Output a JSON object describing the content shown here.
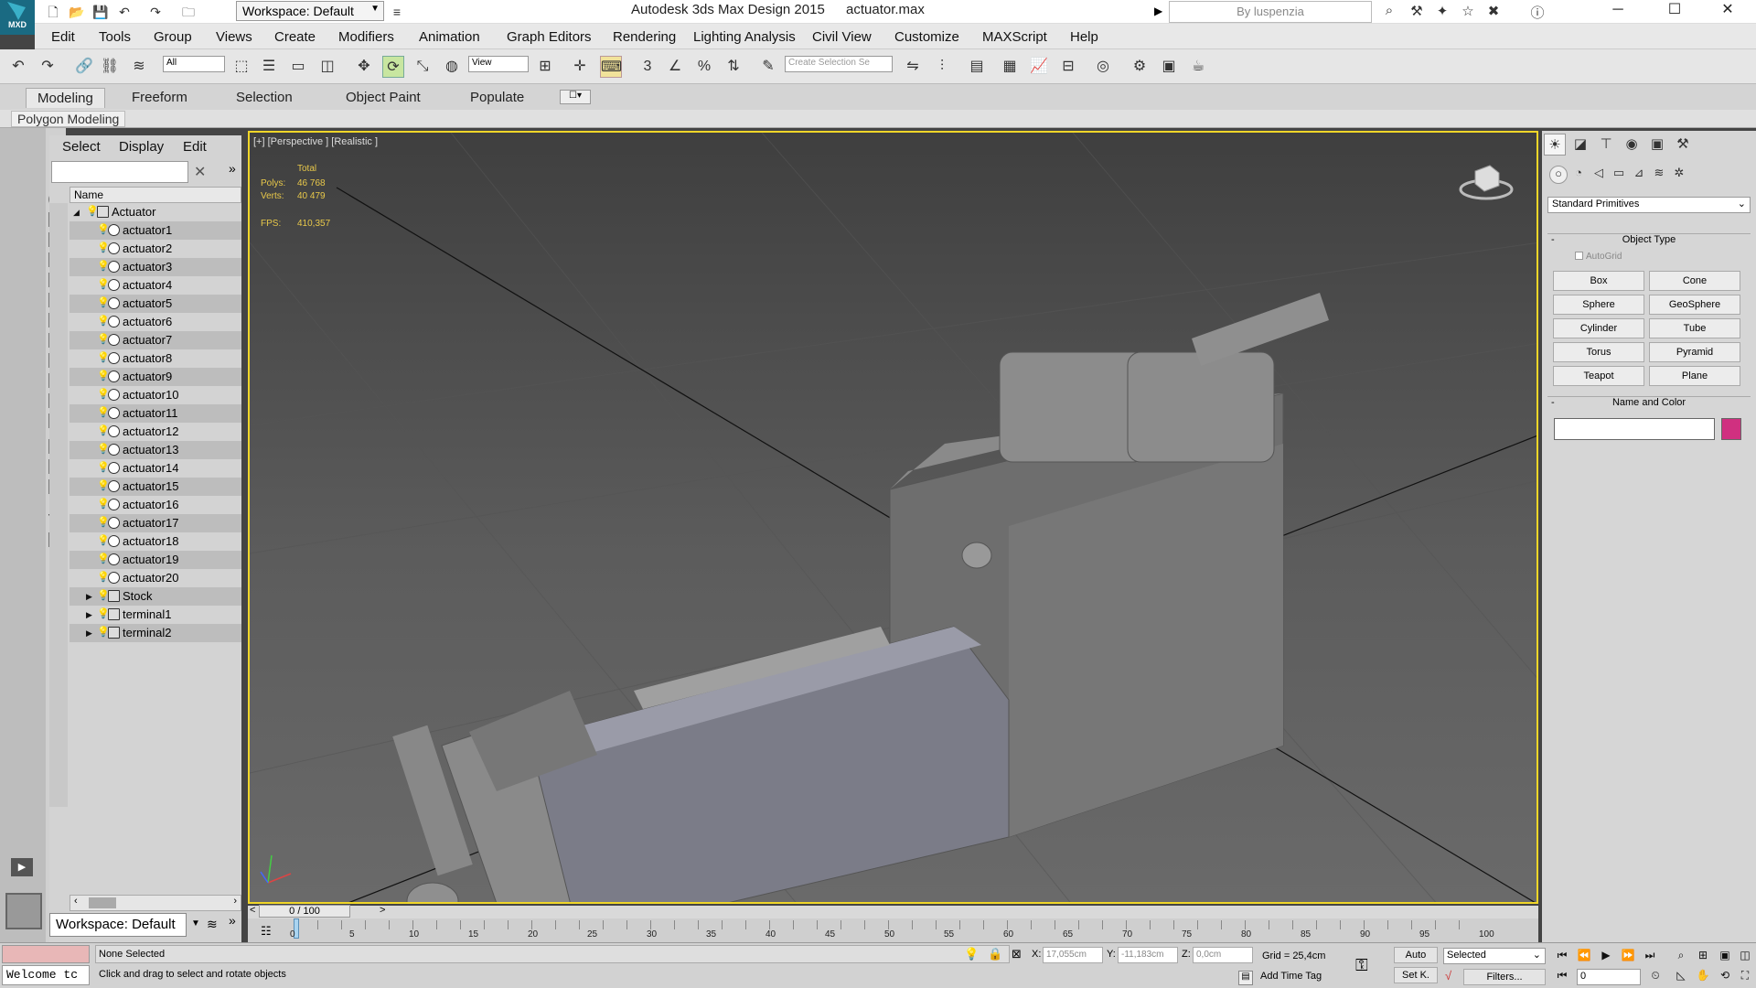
{
  "titlebar": {
    "logo_text": "MXD",
    "workspace": "Workspace: Default",
    "app_title": "Autodesk 3ds Max Design 2015",
    "file_name": "actuator.max",
    "search_placeholder": "By luspenzia"
  },
  "menu": [
    "Edit",
    "Tools",
    "Group",
    "Views",
    "Create",
    "Modifiers",
    "Animation",
    "Graph Editors",
    "Rendering",
    "Lighting Analysis",
    "Civil View",
    "Customize",
    "MAXScript",
    "Help"
  ],
  "main_toolbar": {
    "filter_dd": "All",
    "ref_coord_dd": "View",
    "selection_set_placeholder": "Create Selection Se"
  },
  "ribbon": {
    "tabs": [
      "Modeling",
      "Freeform",
      "Selection",
      "Object Paint",
      "Populate"
    ],
    "active_tab": "Modeling",
    "panel_label": "Polygon Modeling"
  },
  "scene_explorer": {
    "menus": [
      "Select",
      "Display",
      "Edit"
    ],
    "column_header": "Name",
    "root": "Actuator",
    "items": [
      {
        "label": "actuator1",
        "selected": true
      },
      {
        "label": "actuator2",
        "selected": false
      },
      {
        "label": "actuator3",
        "selected": true
      },
      {
        "label": "actuator4",
        "selected": false
      },
      {
        "label": "actuator5",
        "selected": true
      },
      {
        "label": "actuator6",
        "selected": false
      },
      {
        "label": "actuator7",
        "selected": true
      },
      {
        "label": "actuator8",
        "selected": false
      },
      {
        "label": "actuator9",
        "selected": true
      },
      {
        "label": "actuator10",
        "selected": false
      },
      {
        "label": "actuator11",
        "selected": true
      },
      {
        "label": "actuator12",
        "selected": false
      },
      {
        "label": "actuator13",
        "selected": true
      },
      {
        "label": "actuator14",
        "selected": false
      },
      {
        "label": "actuator15",
        "selected": true
      },
      {
        "label": "actuator16",
        "selected": false
      },
      {
        "label": "actuator17",
        "selected": true
      },
      {
        "label": "actuator18",
        "selected": false
      },
      {
        "label": "actuator19",
        "selected": true
      },
      {
        "label": "actuator20",
        "selected": false
      }
    ],
    "groups": [
      "Stock",
      "terminal1",
      "terminal2"
    ],
    "workspace": "Workspace: Default"
  },
  "viewport": {
    "label": "[+] [Perspective ] [Realistic ]",
    "stats_header": "Total",
    "polys_label": "Polys:",
    "polys_value": "46 768",
    "verts_label": "Verts:",
    "verts_value": "40 479",
    "fps_label": "FPS:",
    "fps_value": "410,357"
  },
  "command_panel": {
    "dropdown": "Standard Primitives",
    "object_type_title": "Object Type",
    "autogrid": "AutoGrid",
    "primitives": [
      "Box",
      "Cone",
      "Sphere",
      "GeoSphere",
      "Cylinder",
      "Tube",
      "Torus",
      "Pyramid",
      "Teapot",
      "Plane"
    ],
    "name_color_title": "Name and Color",
    "color": "#d03080"
  },
  "timeline": {
    "slider_value": "0 / 100",
    "ticks": [
      "0",
      "5",
      "10",
      "15",
      "20",
      "25",
      "30",
      "35",
      "40",
      "45",
      "50",
      "55",
      "60",
      "65",
      "70",
      "75",
      "80",
      "85",
      "90",
      "95",
      "100"
    ]
  },
  "status": {
    "welcome": "Welcome tc",
    "selection": "None Selected",
    "prompt": "Click and drag to select and rotate objects",
    "x_label": "X:",
    "x_value": "17,055cm",
    "y_label": "Y:",
    "y_value": "-11,183cm",
    "z_label": "Z:",
    "z_value": "0,0cm",
    "grid": "Grid = 25,4cm",
    "add_time_tag": "Add Time Tag",
    "auto": "Auto",
    "set_key": "Set K.",
    "key_mode": "Selected",
    "filters": "Filters...",
    "frame": "0"
  }
}
